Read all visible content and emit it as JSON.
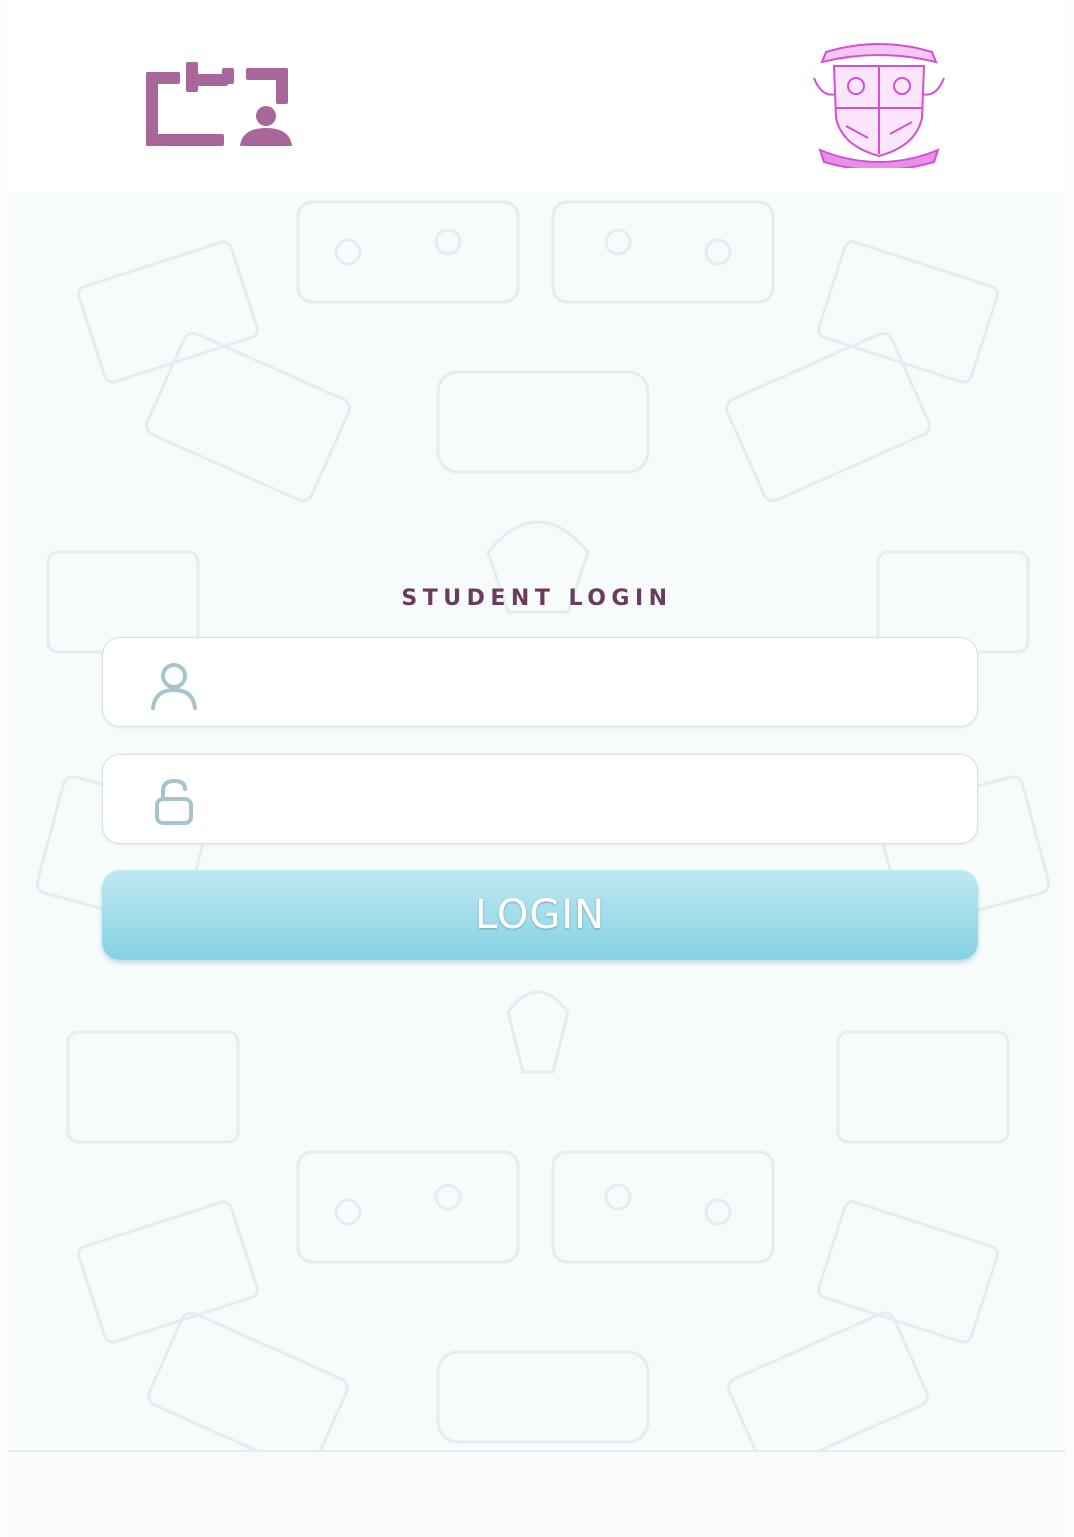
{
  "header": {
    "app_logo_icon": "attendance-board-icon",
    "crest_icon": "college-crest-icon",
    "accent_color": "#a8669a",
    "crest_color": "#d64fd6"
  },
  "login": {
    "title": "STUDENT LOGIN",
    "username_icon": "user-icon",
    "username_value": "",
    "password_icon": "lock-icon",
    "password_value": "",
    "button_label": "LOGIN",
    "button_color": "#9ed9e8"
  }
}
